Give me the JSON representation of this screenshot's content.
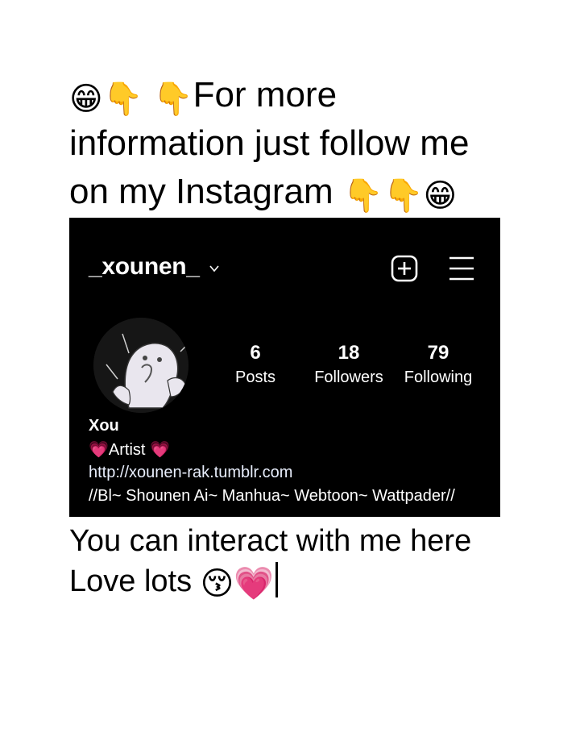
{
  "intro": {
    "emoji_grin": "😁",
    "emoji_point_down": "👇",
    "line1_text": "For more",
    "line2_text": "information just follow me",
    "line3_text": "on my Instagram"
  },
  "instagram": {
    "username": "_xounen_",
    "icons": {
      "dropdown": "chevron-down-icon",
      "add": "add-post-icon",
      "menu": "hamburger-menu-icon"
    },
    "stats": [
      {
        "value": "6",
        "label": "Posts"
      },
      {
        "value": "18",
        "label": "Followers"
      },
      {
        "value": "79",
        "label": "Following"
      }
    ],
    "bio": {
      "name": "Xou",
      "heart": "💗",
      "role": "Artist",
      "link": "http://xounen-rak.tumblr.com",
      "tags": "//Bl~ Shounen Ai~ Manhua~ Webtoon~ Wattpader//"
    }
  },
  "outro": {
    "line1": "You can interact with me here",
    "line2_text": "Love lots",
    "emoji_kiss": "😚",
    "emoji_heart": "💗"
  },
  "colors": {
    "card_background": "#000000",
    "page_background": "#ffffff",
    "heart": "#ff4f8b"
  }
}
